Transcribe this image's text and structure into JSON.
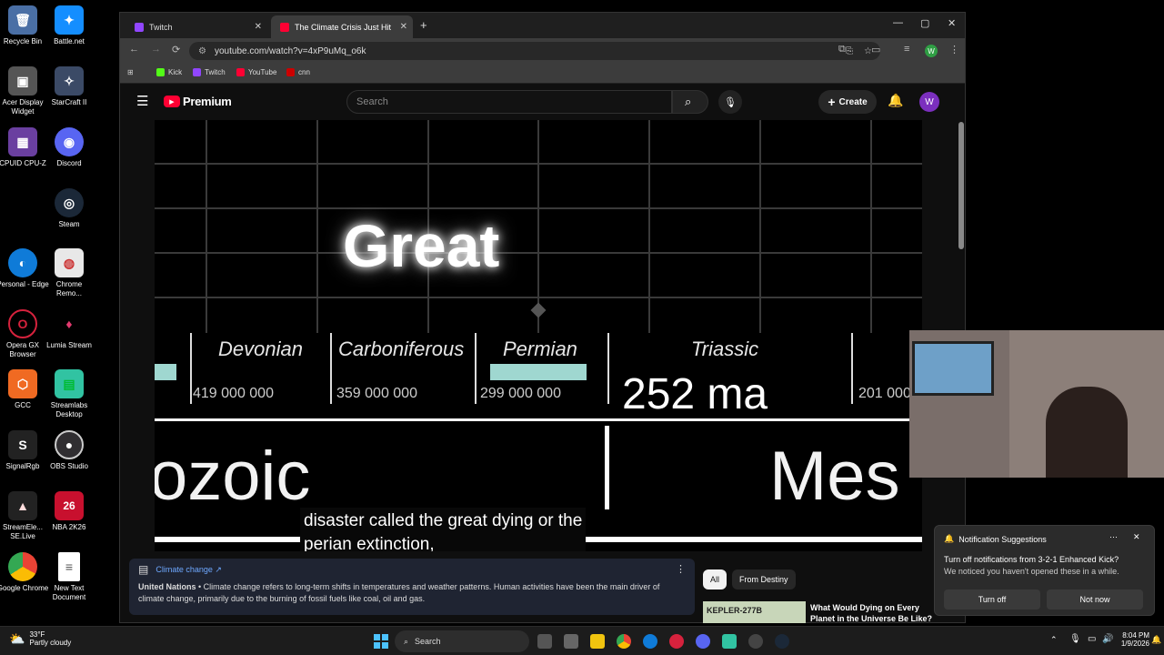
{
  "desktop": {
    "icons": [
      {
        "label": "Recycle Bin",
        "glyph": "🗑",
        "color": "#4a6fa5"
      },
      {
        "label": "Battle.net",
        "glyph": "✦",
        "color": "#148eff"
      },
      {
        "label": "Acer Display Widget",
        "glyph": "▣",
        "color": "#555"
      },
      {
        "label": "StarCraft II",
        "glyph": "✧",
        "color": "#3b4a66"
      },
      {
        "label": "CPUID CPU-Z",
        "glyph": "▦",
        "color": "#6a3fa0"
      },
      {
        "label": "Discord",
        "glyph": "◉",
        "color": "#5865f2"
      },
      {
        "label": "Steam",
        "glyph": "◎",
        "color": "#1b2838"
      },
      {
        "label": "Personal - Edge",
        "glyph": "◐",
        "color": "#0f7bd8"
      },
      {
        "label": "Chrome Remo...",
        "glyph": "◍",
        "color": "#e8e8e8"
      },
      {
        "label": "Opera GX Browser",
        "glyph": "O",
        "color": "#d6223d"
      },
      {
        "label": "Lumia Stream",
        "glyph": "♦",
        "color": "#e23a6f"
      },
      {
        "label": "GCC",
        "glyph": "⬡",
        "color": "#f06a22"
      },
      {
        "label": "Streamlabs Desktop",
        "glyph": "▤",
        "color": "#31c3a2"
      },
      {
        "label": "SignalRgb",
        "glyph": "S",
        "color": "#222"
      },
      {
        "label": "OBS Studio",
        "glyph": "●",
        "color": "#302e31"
      },
      {
        "label": "StreamEle... SE.Live",
        "glyph": "▲",
        "color": "#222"
      },
      {
        "label": "NBA 2K26",
        "glyph": "26",
        "color": "#c8102e"
      },
      {
        "label": "Google Chrome",
        "glyph": "◍",
        "color": "#e8e8e8"
      },
      {
        "label": "New Text Document",
        "glyph": "≡",
        "color": "#ffffff"
      }
    ]
  },
  "browser": {
    "tabs": [
      {
        "title": "Twitch",
        "fav": "#9146ff"
      },
      {
        "title": "The Climate Crisis Just Hit a",
        "fav": "#ff0033"
      }
    ],
    "new_tab": "+",
    "url": "youtube.com/watch?v=4xP9uMq_o6k",
    "bookmarks": [
      {
        "label": "Kick",
        "color": "#53fc18"
      },
      {
        "label": "Twitch",
        "color": "#9146ff"
      },
      {
        "label": "YouTube",
        "color": "#ff0033"
      },
      {
        "label": "cnn",
        "color": "#cc0000"
      }
    ],
    "profile_initial": "W"
  },
  "youtube": {
    "brand": "Premium",
    "search_placeholder": "Search",
    "create_label": "Create",
    "avatar_initial": "W",
    "video": {
      "headline": "Great",
      "periods": [
        {
          "name": "Devonian",
          "age": "419 000 000"
        },
        {
          "name": "Carboniferous",
          "age": "359 000 000"
        },
        {
          "name": "Permian",
          "age": "299 000 000"
        },
        {
          "name": "Triassic",
          "age": "252 ma"
        },
        {
          "name": "",
          "age": "201 000"
        }
      ],
      "era_left": "ozoic",
      "era_right": "Mes",
      "caption_line1": "disaster called the great dying or the",
      "caption_line2": "perian extinction,"
    },
    "info_panel": {
      "topic": "Climate change ↗",
      "source": "United Nations",
      "text": " • Climate change refers to long-term shifts in temperatures and weather patterns. Human activities have been the main driver of climate change, primarily due to the burning of fossil fuels like coal, oil and gas."
    },
    "chips": [
      "All",
      "From Destiny"
    ],
    "rec_title": "What Would Dying on Every Planet in the Universe Be Like?",
    "rec_thumb_text": "KEPLER-277B"
  },
  "notification": {
    "header": "Notification Suggestions",
    "line1": "Turn off notifications from 3-2-1 Enhanced Kick?",
    "line2": "We noticed you haven't opened these in a while.",
    "turn_off": "Turn off",
    "not_now": "Not now"
  },
  "taskbar": {
    "temp": "33°F",
    "weather": "Partly cloudy",
    "search": "Search",
    "time": "8:04 PM",
    "date": "1/9/2026"
  }
}
